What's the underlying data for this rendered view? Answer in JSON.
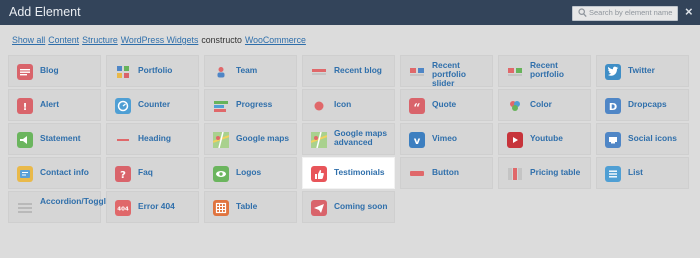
{
  "window": {
    "title": "Add Element",
    "search_placeholder": "Search by element name",
    "close_label": "×"
  },
  "filters": [
    {
      "label": "Show all",
      "link": true
    },
    {
      "label": "Content",
      "link": true
    },
    {
      "label": "Structure",
      "link": true
    },
    {
      "label": "WordPress Widgets",
      "link": true
    },
    {
      "label": "constructo",
      "link": false
    },
    {
      "label": "WooCommerce",
      "link": true
    }
  ],
  "elements": [
    {
      "label": "Blog",
      "icon": "blog-icon",
      "color": "#d9646b"
    },
    {
      "label": "Portfolio",
      "icon": "portfolio-icon",
      "color": "#e0686a"
    },
    {
      "label": "Team",
      "icon": "team-icon",
      "color": "#e9e9e9"
    },
    {
      "label": "Recent blog",
      "icon": "recent-blog-icon",
      "color": "#e2656a"
    },
    {
      "label": "Recent portfolio slider",
      "icon": "recent-portfolio-slider-icon",
      "color": "#e2656a"
    },
    {
      "label": "Recent portfolio",
      "icon": "recent-portfolio-icon",
      "color": "#e2656a"
    },
    {
      "label": "Twitter",
      "icon": "twitter-icon",
      "color": "#3f8ec6"
    },
    {
      "label": "Alert",
      "icon": "alert-icon",
      "color": "#d9646b"
    },
    {
      "label": "Counter",
      "icon": "counter-icon",
      "color": "#4f9fd4"
    },
    {
      "label": "Progress",
      "icon": "progress-icon",
      "color": "#67b35a"
    },
    {
      "label": "Icon",
      "icon": "icon-icon",
      "color": "#e9e9e9"
    },
    {
      "label": "Quote",
      "icon": "quote-icon",
      "color": "#d9646b"
    },
    {
      "label": "Color",
      "icon": "color-icon",
      "color": "#e9e9e9"
    },
    {
      "label": "Dropcaps",
      "icon": "dropcaps-icon",
      "color": "#4f86c6"
    },
    {
      "label": "Statement",
      "icon": "statement-icon",
      "color": "#6bb55e"
    },
    {
      "label": "Heading",
      "icon": "heading-icon",
      "color": "#e9e9e9"
    },
    {
      "label": "Google maps",
      "icon": "google-maps-icon",
      "color": "#8fbf6a"
    },
    {
      "label": "Google maps advanced",
      "icon": "google-maps-advanced-icon",
      "color": "#8fbf6a"
    },
    {
      "label": "Vimeo",
      "icon": "vimeo-icon",
      "color": "#3d7fc0"
    },
    {
      "label": "Youtube",
      "icon": "youtube-icon",
      "color": "#c7343b"
    },
    {
      "label": "Social icons",
      "icon": "social-icons-icon",
      "color": "#4f86c6"
    },
    {
      "label": "Contact info",
      "icon": "contact-info-icon",
      "color": "#e9b94a"
    },
    {
      "label": "Faq",
      "icon": "faq-icon",
      "color": "#d9646b"
    },
    {
      "label": "Logos",
      "icon": "logos-icon",
      "color": "#6bb55e"
    },
    {
      "label": "Testimonials",
      "icon": "testimonials-icon",
      "color": "#e8555a",
      "active": true
    },
    {
      "label": "Button",
      "icon": "button-icon",
      "color": "#e9e9e9"
    },
    {
      "label": "Pricing table",
      "icon": "pricing-table-icon",
      "color": "#e9e9e9"
    },
    {
      "label": "List",
      "icon": "list-icon",
      "color": "#4f9fd4"
    },
    {
      "label": "Accordion/Toggle",
      "icon": "accordion-toggle-icon",
      "color": "#e9e9e9"
    },
    {
      "label": "Error 404",
      "icon": "error-404-icon",
      "color": "#e0686a",
      "glyph": "404"
    },
    {
      "label": "Table",
      "icon": "table-icon",
      "color": "#e0743f"
    },
    {
      "label": "Coming soon",
      "icon": "coming-soon-icon",
      "color": "#d9646b"
    }
  ]
}
